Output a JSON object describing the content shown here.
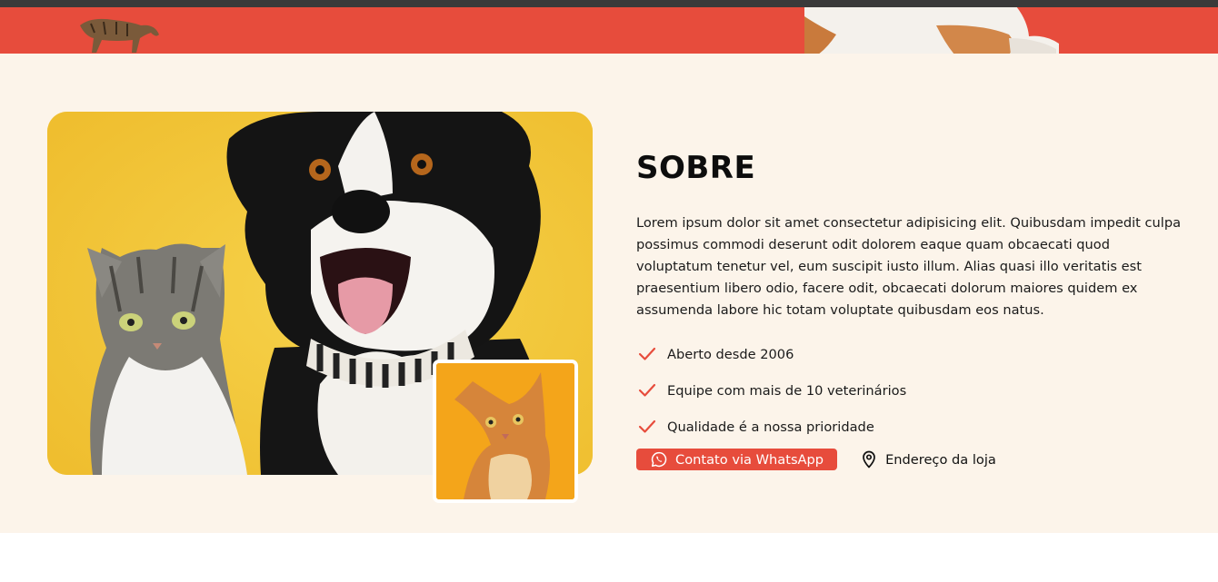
{
  "about": {
    "title": "SOBRE",
    "description": "Lorem ipsum dolor sit amet consectetur adipisicing elit. Quibusdam impedit culpa possimus commodi deserunt odit dolorem eaque quam obcaecati quod voluptatum tenetur vel, eum suscipit iusto illum. Alias quasi illo veritatis est praesentium libero odio, facere odit, obcaecati dolorum maiores quidem ex assumenda labore hic totam voluptate quibusdam eos natus.",
    "features": [
      {
        "icon": "check-icon",
        "label": "Aberto desde 2006"
      },
      {
        "icon": "check-icon",
        "label": "Equipe com mais de 10 veterinários"
      },
      {
        "icon": "check-icon",
        "label": "Qualidade é a nossa prioridade"
      }
    ],
    "whatsapp_button": {
      "icon": "whatsapp-icon",
      "label": "Contato via WhatsApp"
    },
    "address_link": {
      "icon": "map-pin-icon",
      "label": "Endereço da loja"
    }
  },
  "colors": {
    "accent": "#e74c3c",
    "section_background": "#fcf4ea",
    "top_bar": "#3a3a3a"
  }
}
